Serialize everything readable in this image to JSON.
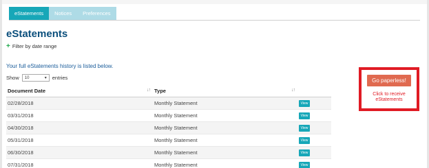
{
  "tabs": [
    {
      "label": "eStatements",
      "active": true
    },
    {
      "label": "Notices",
      "active": false
    },
    {
      "label": "Preferences",
      "active": false
    }
  ],
  "page_title": "eStatements",
  "filter_label": "Filter by date range",
  "history_text": "Your full eStatements history is listed below.",
  "length_control": {
    "show_label": "Show",
    "selected_value": "10",
    "entries_label": "entries"
  },
  "table": {
    "columns": [
      "Document Date",
      "Type"
    ],
    "rows": [
      {
        "date": "02/28/2018",
        "type": "Monthly Statement",
        "action": "View"
      },
      {
        "date": "03/31/2018",
        "type": "Monthly Statement",
        "action": "View"
      },
      {
        "date": "04/30/2018",
        "type": "Monthly Statement",
        "action": "View"
      },
      {
        "date": "05/31/2018",
        "type": "Monthly Statement",
        "action": "View"
      },
      {
        "date": "06/30/2018",
        "type": "Monthly Statement",
        "action": "View"
      },
      {
        "date": "07/31/2018",
        "type": "Monthly Statement",
        "action": "View"
      }
    ]
  },
  "promo": {
    "button_label": "Go paperless!",
    "link_text": "Click to receive eStatements"
  },
  "icons": {
    "filter": "plus-icon",
    "sort": "sort-icon",
    "select": "chevron-down-icon"
  },
  "colors": {
    "accent": "#17a7b8",
    "title": "#0b4f7c",
    "promo_border": "#e01b24",
    "promo_button": "#e06a50"
  }
}
